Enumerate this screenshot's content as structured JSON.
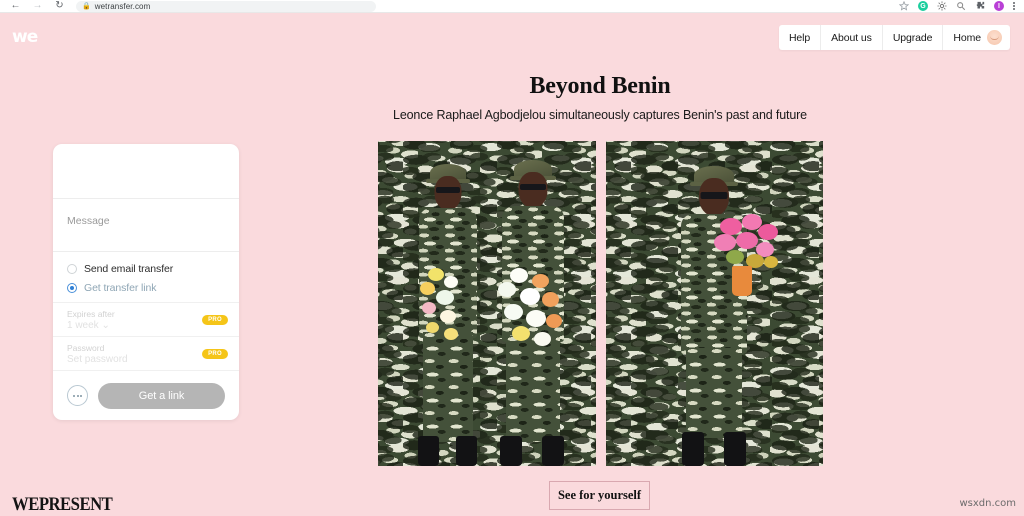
{
  "browser": {
    "back_icon": "back-arrow-icon",
    "forward_icon": "forward-arrow-icon",
    "reload_icon": "reload-icon",
    "lock_icon": "lock-icon",
    "url": "wetransfer.com",
    "toolbar_icons": [
      "star-icon",
      "green-extension-icon",
      "gear-extension-icon",
      "magnifier-extension-icon",
      "puzzle-extensions-icon",
      "profile-avatar-icon",
      "kebab-menu-icon"
    ]
  },
  "header": {
    "logo": "we",
    "nav": [
      {
        "label": "Help"
      },
      {
        "label": "About us"
      },
      {
        "label": "Upgrade"
      },
      {
        "label": "Home"
      }
    ],
    "avatar": "user-avatar"
  },
  "hero": {
    "title": "Beyond Benin",
    "subtitle": "Leonce Raphael Agbodjelou simultaneously captures Benin's past and future",
    "cta": "See for yourself"
  },
  "panel": {
    "message_placeholder": "Message",
    "options": [
      {
        "label": "Send email transfer",
        "selected": false
      },
      {
        "label": "Get transfer link",
        "selected": true
      }
    ],
    "expires": {
      "label": "Expires after",
      "value": "1 week",
      "badge": "PRO"
    },
    "password": {
      "label": "Password",
      "value": "Set password",
      "badge": "PRO"
    },
    "more_button": "more-options",
    "submit_label": "Get a link"
  },
  "photos": [
    {
      "alt": "Two figures in camouflage uniforms holding bouquets against a camouflage backdrop"
    },
    {
      "alt": "Single figure in camouflage uniform holding pink bouquet against a camouflage backdrop"
    }
  ],
  "footer": {
    "brand": "WEPRESENT",
    "watermark": "wsxdn.com"
  },
  "colors": {
    "page_background": "#fadadd",
    "pro_badge": "#f5c518",
    "submit_button": "#b5b5b5",
    "radio_selected": "#2f80d6"
  }
}
